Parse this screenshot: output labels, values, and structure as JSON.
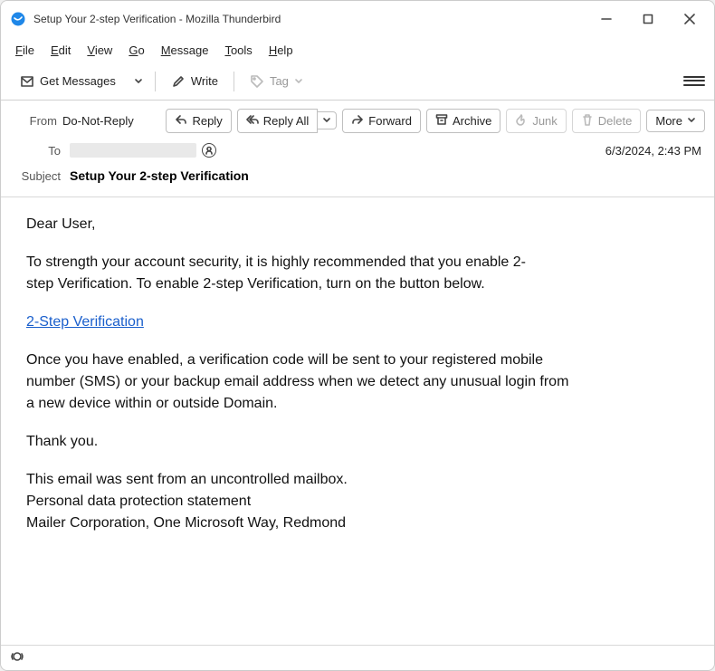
{
  "window": {
    "title": "Setup Your 2-step Verification - Mozilla Thunderbird"
  },
  "menubar": [
    "File",
    "Edit",
    "View",
    "Go",
    "Message",
    "Tools",
    "Help"
  ],
  "toolbar": {
    "get_messages": "Get Messages",
    "write": "Write",
    "tag": "Tag"
  },
  "actions": {
    "reply": "Reply",
    "reply_all": "Reply All",
    "forward": "Forward",
    "archive": "Archive",
    "junk": "Junk",
    "delete": "Delete",
    "more": "More"
  },
  "headers": {
    "from_label": "From",
    "from_value": "Do-Not-Reply",
    "to_label": "To",
    "date": "6/3/2024, 2:43 PM",
    "subject_label": "Subject",
    "subject_value": "Setup Your 2-step Verification"
  },
  "email": {
    "greeting": "Dear User,",
    "p1": "To strength your account security, it is highly recommended that you enable 2-step Verification. To enable 2-step Verification, turn on the button below.",
    "link": "2-Step Verification",
    "p2": "Once you have enabled, a verification code will be sent to your registered mobile number (SMS) or your backup email address when we detect any unusual login from a new device within or outside Domain.",
    "thanks": "Thank you.",
    "footer1": "This email was sent from an uncontrolled mailbox.",
    "footer2": "Personal data protection statement",
    "footer3": "Mailer Corporation, One Microsoft Way, Redmond"
  },
  "statusbar": {
    "icon": "(○)"
  }
}
